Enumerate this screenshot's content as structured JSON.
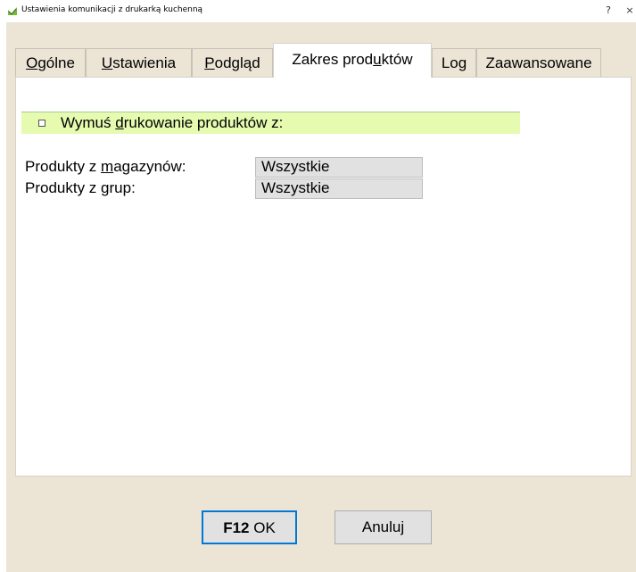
{
  "window": {
    "title": "Ustawienia komunikacji z drukarką kuchenną",
    "help_label": "?",
    "close_label": "×"
  },
  "tabs": [
    {
      "label_u": "O",
      "label_rest": "gólne",
      "active": false
    },
    {
      "label_u": "U",
      "label_rest": "stawienia",
      "active": false
    },
    {
      "label_u": "P",
      "label_rest": "odgląd",
      "active": false
    },
    {
      "label_pre": "Zakres prod",
      "label_u": "u",
      "label_rest": "któw",
      "active": true
    },
    {
      "label": "Log",
      "active": false
    },
    {
      "label": "Zaawansowane",
      "active": false
    }
  ],
  "force_print": {
    "checked": false,
    "label_pre": "Wymuś ",
    "label_u": "d",
    "label_rest": "rukowanie produktów z:"
  },
  "fields": {
    "warehouses": {
      "label_pre": "Produkty z ",
      "label_u": "m",
      "label_rest": "agazynów:",
      "value": "Wszystkie"
    },
    "groups": {
      "label_pre": "Produkty z ",
      "label_u": "g",
      "label_rest": "rup:",
      "value": "Wszystkie"
    }
  },
  "buttons": {
    "ok_key": "F12",
    "ok_label": " OK",
    "cancel_label": "Anuluj"
  },
  "colors": {
    "dialog_bg": "#ece5d6",
    "highlight_row": "#e6fbb0",
    "focus_border": "#0078d7"
  }
}
